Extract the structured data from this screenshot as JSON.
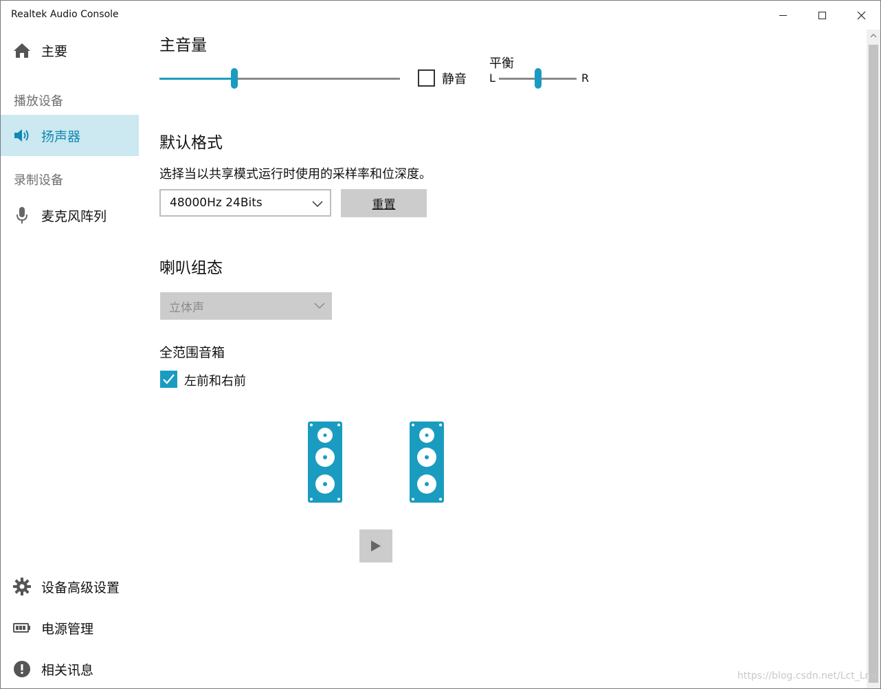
{
  "window": {
    "title": "Realtek Audio Console"
  },
  "sidebar": {
    "home": {
      "label": "主要",
      "icon": "home-icon"
    },
    "section_playback": "播放设备",
    "speaker": {
      "label": "扬声器",
      "icon": "speaker-icon"
    },
    "section_record": "录制设备",
    "mic": {
      "label": "麦克风阵列",
      "icon": "microphone-icon"
    },
    "advanced": {
      "label": "设备高级设置",
      "icon": "gear-icon"
    },
    "power": {
      "label": "电源管理",
      "icon": "battery-icon"
    },
    "info": {
      "label": "相关讯息",
      "icon": "info-icon"
    }
  },
  "volume": {
    "title": "主音量",
    "level": 0.31,
    "mute_label": "静音",
    "mute_checked": false,
    "balance_label": "平衡",
    "balance_left": "L",
    "balance_right": "R",
    "balance_level": 0.5
  },
  "format": {
    "title": "默认格式",
    "description": "选择当以共享模式运行时使用的采样率和位深度。",
    "selected": "48000Hz 24Bits",
    "reset_label": "重置"
  },
  "speaker_config": {
    "title": "喇叭组态",
    "selected": "立体声",
    "fullrange_title": "全范围音箱",
    "front_lr_label": "左前和右前",
    "front_lr_checked": true
  },
  "watermark": "https://blog.csdn.net/Lct_Lmi",
  "colors": {
    "accent": "#1a9cc0",
    "active_bg": "#cce8f0",
    "active_text": "#1089b3",
    "button_bg": "#cccccc"
  }
}
